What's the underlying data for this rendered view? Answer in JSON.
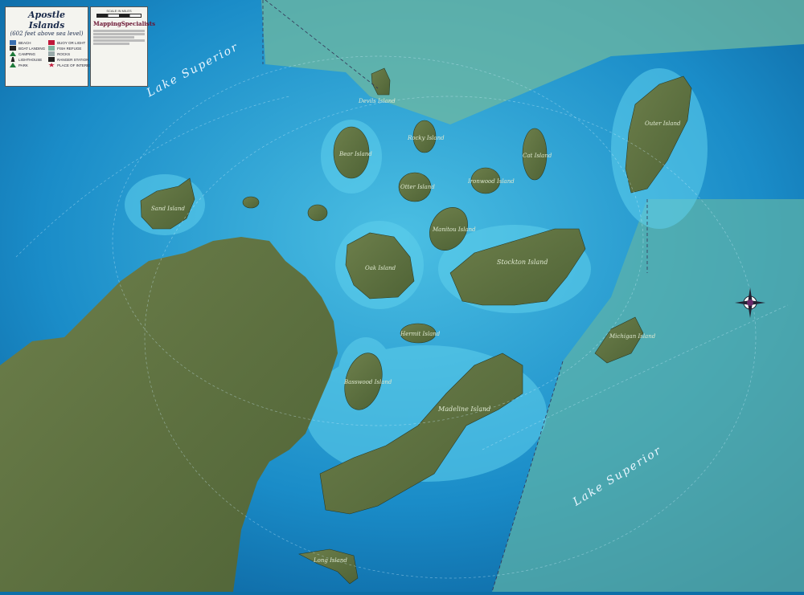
{
  "legend": {
    "title": "Apostle Islands",
    "subtitle": "(602 feet above sea level)",
    "items": [
      {
        "label": "BEACH",
        "icon": "beach-icon",
        "color": "#3a6fb0"
      },
      {
        "label": "BUOY OR LIGHT",
        "icon": "buoy-icon",
        "color": "#c0183a"
      },
      {
        "label": "BOAT LANDING",
        "icon": "boat-landing-icon",
        "color": "#222222"
      },
      {
        "label": "FISH REFUGE",
        "icon": "fish-refuge-icon",
        "color": "#7fb3a0"
      },
      {
        "label": "CAMPING",
        "icon": "camping-icon",
        "color": "#1e7a3a"
      },
      {
        "label": "ROCKS",
        "icon": "rocks-icon",
        "color": "#9aa"
      },
      {
        "label": "LIGHTHOUSE",
        "icon": "lighthouse-icon",
        "color": "#222222"
      },
      {
        "label": "RANGER STATION",
        "icon": "ranger-station-icon",
        "color": "#222222"
      },
      {
        "label": "PARK",
        "icon": "park-icon",
        "color": "#1e7a3a"
      },
      {
        "label": "PLACE OF INTEREST",
        "icon": "star-icon",
        "color": "#c0183a"
      }
    ]
  },
  "info": {
    "scale_label": "SCALE IN MILES",
    "brand": "MappingSpecialists"
  },
  "labels": {
    "lake_nw": "Lake Superior",
    "lake_se": "Lake Superior",
    "islands": [
      {
        "id": "sand",
        "name": "Sand Island"
      },
      {
        "id": "bear",
        "name": "Bear Island"
      },
      {
        "id": "devils",
        "name": "Devils Island"
      },
      {
        "id": "rocky",
        "name": "Rocky Island"
      },
      {
        "id": "otter",
        "name": "Otter Island"
      },
      {
        "id": "ironwood",
        "name": "Ironwood Island"
      },
      {
        "id": "manitou",
        "name": "Manitou Island"
      },
      {
        "id": "cat",
        "name": "Cat Island"
      },
      {
        "id": "outer",
        "name": "Outer Island"
      },
      {
        "id": "oak",
        "name": "Oak Island"
      },
      {
        "id": "stockton",
        "name": "Stockton Island"
      },
      {
        "id": "hermit",
        "name": "Hermit Island"
      },
      {
        "id": "basswood",
        "name": "Basswood Island"
      },
      {
        "id": "madeline",
        "name": "Madeline Island"
      },
      {
        "id": "michigan",
        "name": "Michigan Island"
      },
      {
        "id": "long",
        "name": "Long Island"
      }
    ]
  },
  "colors": {
    "deep_water": "#0b6aa5",
    "shallow_water": "#3cb6dc",
    "land": "#5d7240",
    "fish_refuge": "#66b3a3"
  }
}
